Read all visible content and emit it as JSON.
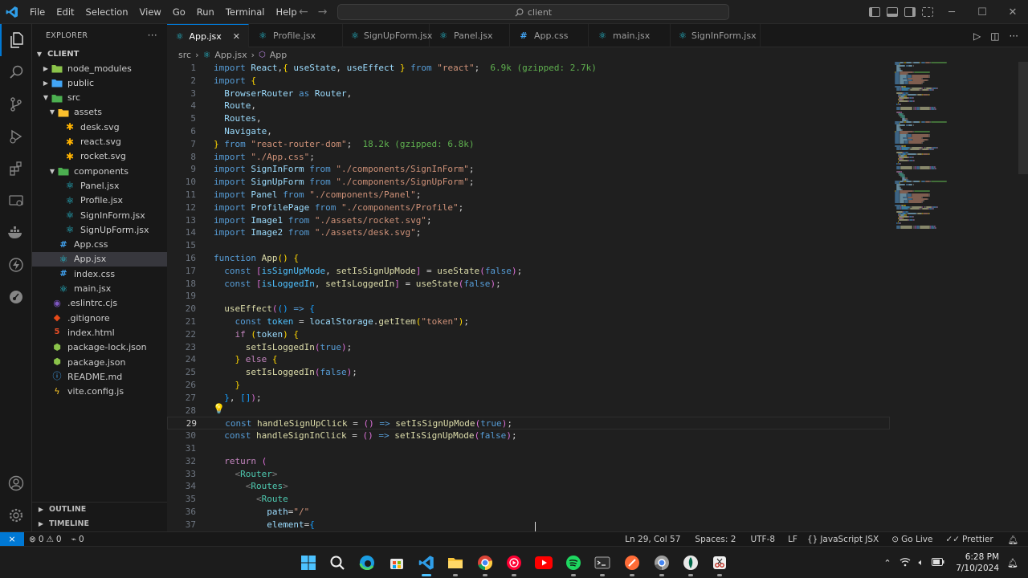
{
  "titlebar": {
    "menu": [
      "File",
      "Edit",
      "Selection",
      "View",
      "Go",
      "Run",
      "Terminal",
      "Help"
    ],
    "search_text": "client",
    "back_icon": "arrow-left-icon",
    "forward_icon": "arrow-right-icon"
  },
  "activity": [
    "explorer-icon",
    "search-icon",
    "source-control-icon",
    "run-debug-icon",
    "extensions-icon",
    "remote-explorer-icon",
    "docker-icon",
    "thunder-client-icon",
    "git-graph-icon",
    "accounts-icon",
    "settings-gear-icon"
  ],
  "sidebar": {
    "title": "EXPLORER",
    "more": "···",
    "root": "CLIENT",
    "tree": [
      {
        "label": "node_modules",
        "depth": 1,
        "type": "folder",
        "open": false,
        "color": "#8bc34a"
      },
      {
        "label": "public",
        "depth": 1,
        "type": "folder",
        "open": false,
        "color": "#42a5f5"
      },
      {
        "label": "src",
        "depth": 1,
        "type": "folder",
        "open": true,
        "color": "#4caf50"
      },
      {
        "label": "assets",
        "depth": 2,
        "type": "folder",
        "open": true,
        "color": "#fbc02d"
      },
      {
        "label": "desk.svg",
        "depth": 3,
        "type": "svg",
        "color": "#ffb300"
      },
      {
        "label": "react.svg",
        "depth": 3,
        "type": "svg",
        "color": "#ffb300"
      },
      {
        "label": "rocket.svg",
        "depth": 3,
        "type": "svg",
        "color": "#ffb300"
      },
      {
        "label": "components",
        "depth": 2,
        "type": "folder",
        "open": true,
        "color": "#4caf50"
      },
      {
        "label": "Panel.jsx",
        "depth": 3,
        "type": "react",
        "color": "#26c6da"
      },
      {
        "label": "Profile.jsx",
        "depth": 3,
        "type": "react",
        "color": "#26c6da"
      },
      {
        "label": "SignInForm.jsx",
        "depth": 3,
        "type": "react",
        "color": "#26c6da"
      },
      {
        "label": "SignUpForm.jsx",
        "depth": 3,
        "type": "react",
        "color": "#26c6da"
      },
      {
        "label": "App.css",
        "depth": 2,
        "type": "css",
        "color": "#42a5f5"
      },
      {
        "label": "App.jsx",
        "depth": 2,
        "type": "react",
        "color": "#26c6da",
        "selected": true
      },
      {
        "label": "index.css",
        "depth": 2,
        "type": "css",
        "color": "#42a5f5"
      },
      {
        "label": "main.jsx",
        "depth": 2,
        "type": "react",
        "color": "#26c6da"
      },
      {
        "label": ".eslintrc.cjs",
        "depth": 1,
        "type": "eslint",
        "color": "#7e57c2"
      },
      {
        "label": ".gitignore",
        "depth": 1,
        "type": "git",
        "color": "#e64a19"
      },
      {
        "label": "index.html",
        "depth": 1,
        "type": "html",
        "color": "#e44d26"
      },
      {
        "label": "package-lock.json",
        "depth": 1,
        "type": "npm",
        "color": "#8bc34a"
      },
      {
        "label": "package.json",
        "depth": 1,
        "type": "npm",
        "color": "#8bc34a"
      },
      {
        "label": "README.md",
        "depth": 1,
        "type": "info",
        "color": "#42a5f5"
      },
      {
        "label": "vite.config.js",
        "depth": 1,
        "type": "vite",
        "color": "#ffca28"
      }
    ],
    "outline": "OUTLINE",
    "timeline": "TIMELINE"
  },
  "tabs": [
    {
      "label": "App.jsx",
      "active": true,
      "color": "#26c6da",
      "close": "✕"
    },
    {
      "label": "Profile.jsx",
      "color": "#26c6da"
    },
    {
      "label": "SignUpForm.jsx",
      "color": "#26c6da"
    },
    {
      "label": "Panel.jsx",
      "color": "#26c6da"
    },
    {
      "label": "App.css",
      "color": "#42a5f5"
    },
    {
      "label": "main.jsx",
      "color": "#26c6da"
    },
    {
      "label": "SignInForm.jsx",
      "color": "#26c6da"
    }
  ],
  "breadcrumb": {
    "folder": "src",
    "file": "App.jsx",
    "symbol": "App",
    "sep": "›"
  },
  "code": [
    [
      [
        "kw",
        "import "
      ],
      [
        "vr",
        "React"
      ],
      [
        "",
        ","
      ],
      [
        "br1",
        "{ "
      ],
      [
        "vr",
        "useState"
      ],
      [
        "",
        ", "
      ],
      [
        "vr",
        "useEffect"
      ],
      [
        "br1",
        " }"
      ],
      [
        "kw",
        " from "
      ],
      [
        "str",
        "\"react\""
      ],
      [
        "",
        ";"
      ],
      [
        "hint",
        "  6.9k (gzipped: 2.7k)"
      ]
    ],
    [
      [
        "kw",
        "import "
      ],
      [
        "br1",
        "{"
      ]
    ],
    [
      [
        "",
        "  "
      ],
      [
        "vr",
        "BrowserRouter"
      ],
      [
        "kw",
        " as "
      ],
      [
        "vr",
        "Router"
      ],
      [
        "",
        ","
      ]
    ],
    [
      [
        "",
        "  "
      ],
      [
        "vr",
        "Route"
      ],
      [
        "",
        ","
      ]
    ],
    [
      [
        "",
        "  "
      ],
      [
        "vr",
        "Routes"
      ],
      [
        "",
        ","
      ]
    ],
    [
      [
        "",
        "  "
      ],
      [
        "vr",
        "Navigate"
      ],
      [
        "",
        ","
      ]
    ],
    [
      [
        "br1",
        "}"
      ],
      [
        "kw",
        " from "
      ],
      [
        "str",
        "\"react-router-dom\""
      ],
      [
        "",
        ";"
      ],
      [
        "hint",
        "  18.2k (gzipped: 6.8k)"
      ]
    ],
    [
      [
        "kw",
        "import "
      ],
      [
        "str",
        "\"./App.css\""
      ],
      [
        "",
        ";"
      ]
    ],
    [
      [
        "kw",
        "import "
      ],
      [
        "vr",
        "SignInForm"
      ],
      [
        "kw",
        " from "
      ],
      [
        "str",
        "\"./components/SignInForm\""
      ],
      [
        "",
        ";"
      ]
    ],
    [
      [
        "kw",
        "import "
      ],
      [
        "vr",
        "SignUpForm"
      ],
      [
        "kw",
        " from "
      ],
      [
        "str",
        "\"./components/SignUpForm\""
      ],
      [
        "",
        ";"
      ]
    ],
    [
      [
        "kw",
        "import "
      ],
      [
        "vr",
        "Panel"
      ],
      [
        "kw",
        " from "
      ],
      [
        "str",
        "\"./components/Panel\""
      ],
      [
        "",
        ";"
      ]
    ],
    [
      [
        "kw",
        "import "
      ],
      [
        "vr",
        "ProfilePage"
      ],
      [
        "kw",
        " from "
      ],
      [
        "str",
        "\"./components/Profile\""
      ],
      [
        "",
        ";"
      ]
    ],
    [
      [
        "kw",
        "import "
      ],
      [
        "vr",
        "Image1"
      ],
      [
        "kw",
        " from "
      ],
      [
        "str",
        "\"./assets/rocket.svg\""
      ],
      [
        "",
        ";"
      ]
    ],
    [
      [
        "kw",
        "import "
      ],
      [
        "vr",
        "Image2"
      ],
      [
        "kw",
        " from "
      ],
      [
        "str",
        "\"./assets/desk.svg\""
      ],
      [
        "",
        ";"
      ]
    ],
    [],
    [
      [
        "kw",
        "function "
      ],
      [
        "fn",
        "App"
      ],
      [
        "br1",
        "() {"
      ]
    ],
    [
      [
        "",
        "  "
      ],
      [
        "kw",
        "const "
      ],
      [
        "br2",
        "["
      ],
      [
        "cst",
        "isSignUpMode"
      ],
      [
        "",
        ", "
      ],
      [
        "fn",
        "setIsSignUpMode"
      ],
      [
        "br2",
        "]"
      ],
      [
        "",
        ""
      ],
      [
        "",
        " = "
      ],
      [
        "fn",
        "useState"
      ],
      [
        "br2",
        "("
      ],
      [
        "kw",
        "false"
      ],
      [
        "br2",
        ")"
      ],
      [
        "",
        ";"
      ]
    ],
    [
      [
        "",
        "  "
      ],
      [
        "kw",
        "const "
      ],
      [
        "br2",
        "["
      ],
      [
        "cst",
        "isLoggedIn"
      ],
      [
        "",
        ", "
      ],
      [
        "fn",
        "setIsLoggedIn"
      ],
      [
        "br2",
        "]"
      ],
      [
        "",
        " = "
      ],
      [
        "fn",
        "useState"
      ],
      [
        "br2",
        "("
      ],
      [
        "kw",
        "false"
      ],
      [
        "br2",
        ")"
      ],
      [
        "",
        ";"
      ]
    ],
    [],
    [
      [
        "",
        "  "
      ],
      [
        "fn",
        "useEffect"
      ],
      [
        "br2",
        "("
      ],
      [
        "br3",
        "()"
      ],
      [
        "kw",
        " => "
      ],
      [
        "br3",
        "{"
      ]
    ],
    [
      [
        "",
        "    "
      ],
      [
        "kw",
        "const "
      ],
      [
        "cst",
        "token"
      ],
      [
        "",
        " = "
      ],
      [
        "vr",
        "localStorage"
      ],
      [
        "",
        "."
      ],
      [
        "fn",
        "getItem"
      ],
      [
        "br1",
        "("
      ],
      [
        "str",
        "\"token\""
      ],
      [
        "br1",
        ")"
      ],
      [
        "",
        ";"
      ]
    ],
    [
      [
        "",
        "    "
      ],
      [
        "ctl",
        "if "
      ],
      [
        "br1",
        "("
      ],
      [
        "vr",
        "token"
      ],
      [
        "br1",
        ")"
      ],
      [
        "br1",
        " {"
      ]
    ],
    [
      [
        "",
        "      "
      ],
      [
        "fn",
        "setIsLoggedIn"
      ],
      [
        "br2",
        "("
      ],
      [
        "kw",
        "true"
      ],
      [
        "br2",
        ")"
      ],
      [
        "",
        ";"
      ]
    ],
    [
      [
        "",
        "    "
      ],
      [
        "br1",
        "}"
      ],
      [
        "ctl",
        " else "
      ],
      [
        "br1",
        "{"
      ]
    ],
    [
      [
        "",
        "      "
      ],
      [
        "fn",
        "setIsLoggedIn"
      ],
      [
        "br2",
        "("
      ],
      [
        "kw",
        "false"
      ],
      [
        "br2",
        ")"
      ],
      [
        "",
        ";"
      ]
    ],
    [
      [
        "",
        "    "
      ],
      [
        "br1",
        "}"
      ]
    ],
    [
      [
        "",
        "  "
      ],
      [
        "br3",
        "}"
      ],
      [
        "",
        ", "
      ],
      [
        "br3",
        "[]"
      ],
      [
        "br2",
        ")"
      ],
      [
        "",
        ";"
      ]
    ],
    [],
    [
      [
        "",
        "  "
      ],
      [
        "kw",
        "const "
      ],
      [
        "fn",
        "handleSignUpClick"
      ],
      [
        "",
        " = "
      ],
      [
        "br2",
        "()"
      ],
      [
        "kw",
        " => "
      ],
      [
        "fn",
        "setIsSignUpMode"
      ],
      [
        "br2",
        "("
      ],
      [
        "kw",
        "true"
      ],
      [
        "br2",
        ")"
      ],
      [
        "",
        ";"
      ]
    ],
    [
      [
        "",
        "  "
      ],
      [
        "kw",
        "const "
      ],
      [
        "fn",
        "handleSignInClick"
      ],
      [
        "",
        " = "
      ],
      [
        "br2",
        "()"
      ],
      [
        "kw",
        " => "
      ],
      [
        "fn",
        "setIsSignUpMode"
      ],
      [
        "br2",
        "("
      ],
      [
        "kw",
        "false"
      ],
      [
        "br2",
        ")"
      ],
      [
        "",
        ";"
      ]
    ],
    [],
    [
      [
        "",
        "  "
      ],
      [
        "ctl",
        "return "
      ],
      [
        "br2",
        "("
      ]
    ],
    [
      [
        "",
        "    "
      ],
      [
        "pun",
        "<"
      ],
      [
        "tag",
        "Router"
      ],
      [
        "pun",
        ">"
      ]
    ],
    [
      [
        "",
        "      "
      ],
      [
        "pun",
        "<"
      ],
      [
        "tag",
        "Routes"
      ],
      [
        "pun",
        ">"
      ]
    ],
    [
      [
        "",
        "        "
      ],
      [
        "pun",
        "<"
      ],
      [
        "tag",
        "Route"
      ]
    ],
    [
      [
        "",
        "          "
      ],
      [
        "attr",
        "path"
      ],
      [
        "",
        "="
      ],
      [
        "str",
        "\"/\""
      ]
    ],
    [
      [
        "",
        "          "
      ],
      [
        "attr",
        "element"
      ],
      [
        "",
        "="
      ],
      [
        "br3",
        "{"
      ]
    ]
  ],
  "current_line": 29,
  "statusbar": {
    "remote": "⨯",
    "problems_errors": "0",
    "problems_warnings": "0",
    "ports": "0",
    "position": "Ln 29, Col 57",
    "spaces": "Spaces: 2",
    "encoding": "UTF-8",
    "eol": "LF",
    "language": "JavaScript JSX",
    "golive": "Go Live",
    "prettier": "Prettier"
  },
  "taskbar": {
    "apps": [
      "windows-start-icon",
      "search-icon",
      "edge-icon",
      "store-icon",
      "vscode-icon",
      "file-explorer-icon",
      "chrome-icon",
      "youtube-music-icon",
      "youtube-icon",
      "spotify-icon",
      "terminal-icon",
      "postman-icon",
      "chrome-dev-icon",
      "mongodb-compass-icon",
      "snipping-tool-icon"
    ],
    "time": "6:28 PM",
    "date": "7/10/2024"
  }
}
